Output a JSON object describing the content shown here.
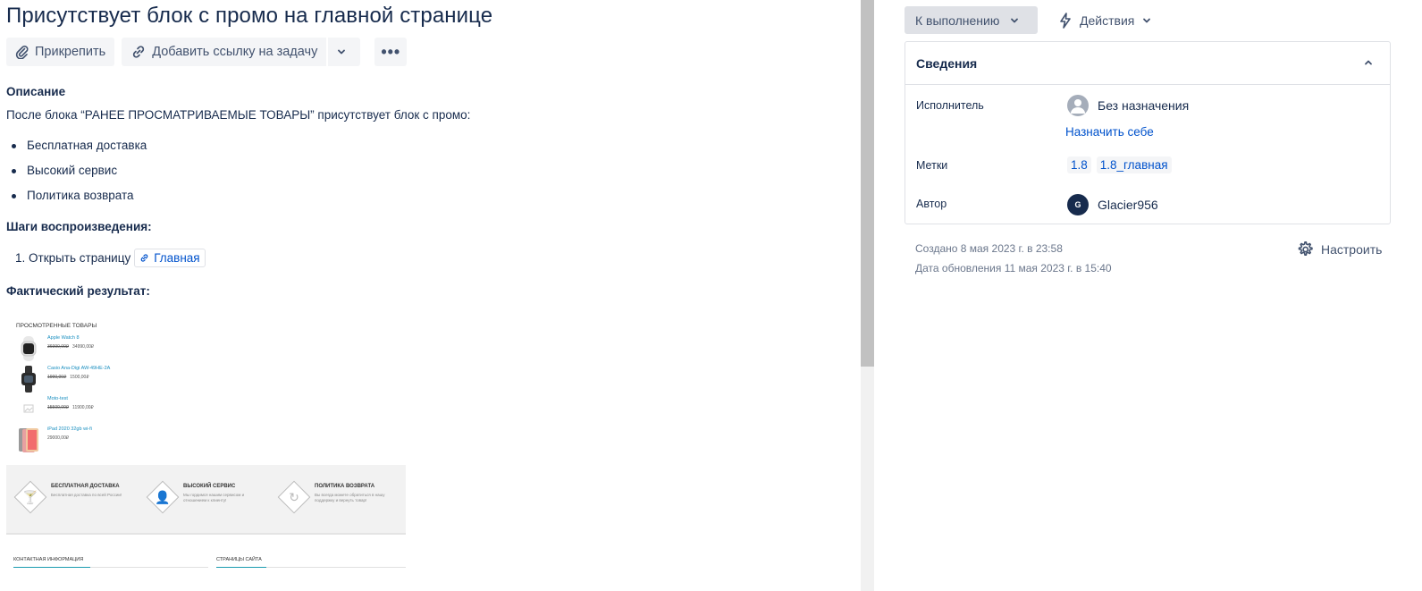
{
  "issue": {
    "title": "Присутствует блок с промо на главной странице"
  },
  "toolbar": {
    "attach_label": "Прикрепить",
    "add_link_label": "Добавить ссылку на задачу",
    "more_label": "•••"
  },
  "description": {
    "heading": "Описание",
    "text": "После блока “РАНЕЕ ПРОСМАТРИВАЕМЫЕ ТОВАРЫ” присутствует блок с промо:",
    "bullets": [
      "Бесплатная доставка",
      "Высокий сервис",
      "Политика возврата"
    ],
    "steps_heading": "Шаги воспроизведения:",
    "step_1_text": "1. Открыть страницу",
    "step_1_link": "Главная",
    "result_heading": "Фактический результат:"
  },
  "screenshot": {
    "title": "ПРОСМОТРЕННЫЕ ТОВАРЫ",
    "products": [
      {
        "name": "Apple Watch 8",
        "old_price": "36990,00₽",
        "price": "34990,00₽"
      },
      {
        "name": "Casio Ana-Digi AW-49HE-2A",
        "old_price": "1990,00₽",
        "price": "1500,00₽"
      },
      {
        "name": "Moto-test",
        "old_price": "15500,00₽",
        "price": "11900,00₽"
      },
      {
        "name": "iPad 2020 32gb wi-fi",
        "old_price": "",
        "price": "29000,00₽"
      }
    ],
    "features": [
      {
        "title": "БЕСПЛАТНАЯ ДОСТАВКА",
        "desc": "Бесплатная доставка по всей России!"
      },
      {
        "title": "ВЫСОКИЙ СЕРВИС",
        "desc": "Мы гордимся нашим сервисом и отношением к клиенту!"
      },
      {
        "title": "ПОЛИТИКА ВОЗВРАТА",
        "desc": "Вы всегда можете обратиться в нашу поддержку и вернуть товар!"
      }
    ],
    "footer_contacts": "КОНТАКТНАЯ ИНФОРМАЦИЯ",
    "footer_pages": "СТРАНИЦЫ САЙТА"
  },
  "sidebar": {
    "status_label": "К выполнению",
    "actions_label": "Действия",
    "details_heading": "Сведения",
    "assignee_label": "Исполнитель",
    "assignee_value": "Без назначения",
    "assign_self": "Назначить себе",
    "labels_label": "Метки",
    "labels": [
      "1.8",
      "1.8_главная"
    ],
    "author_label": "Автор",
    "author_initial": "G",
    "author_name": "Glacier956",
    "created": "Создано 8 мая 2023 г. в 23:58",
    "updated": "Дата обновления 11 мая 2023 г. в 15:40",
    "configure_label": "Настроить"
  }
}
